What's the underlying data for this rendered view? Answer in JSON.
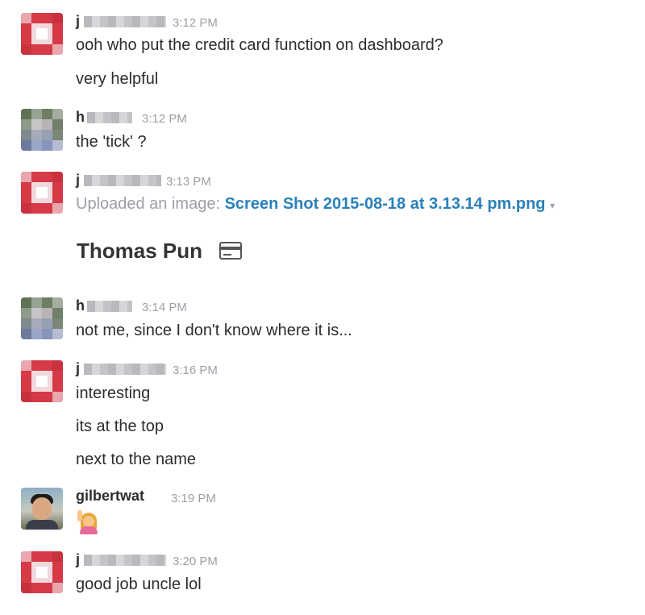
{
  "messages": [
    {
      "user": "j",
      "time": "3:12 PM",
      "lines": [
        "ooh who put the credit card function on dashboard?",
        "very helpful"
      ]
    },
    {
      "user": "h",
      "time": "3:12 PM",
      "lines": [
        "the 'tick' ?"
      ]
    },
    {
      "user": "j",
      "time": "3:13 PM",
      "upload_prefix": "Uploaded an image:",
      "upload_file": "Screen Shot 2015-08-18 at 3.13.14 pm.png",
      "upload_caret": "▾",
      "image_text": "Thomas Pun"
    },
    {
      "user": "h",
      "time": "3:14 PM",
      "lines": [
        "not me, since I don't know where it is..."
      ]
    },
    {
      "user": "j",
      "time": "3:16 PM",
      "lines": [
        "interesting",
        "its at the top",
        "next to the name"
      ]
    },
    {
      "user": "gilbertwat",
      "time": "3:19 PM",
      "emoji": "raising-hand-emoji"
    },
    {
      "user": "j",
      "time": "3:20 PM",
      "lines": [
        "good job uncle lol"
      ]
    }
  ]
}
